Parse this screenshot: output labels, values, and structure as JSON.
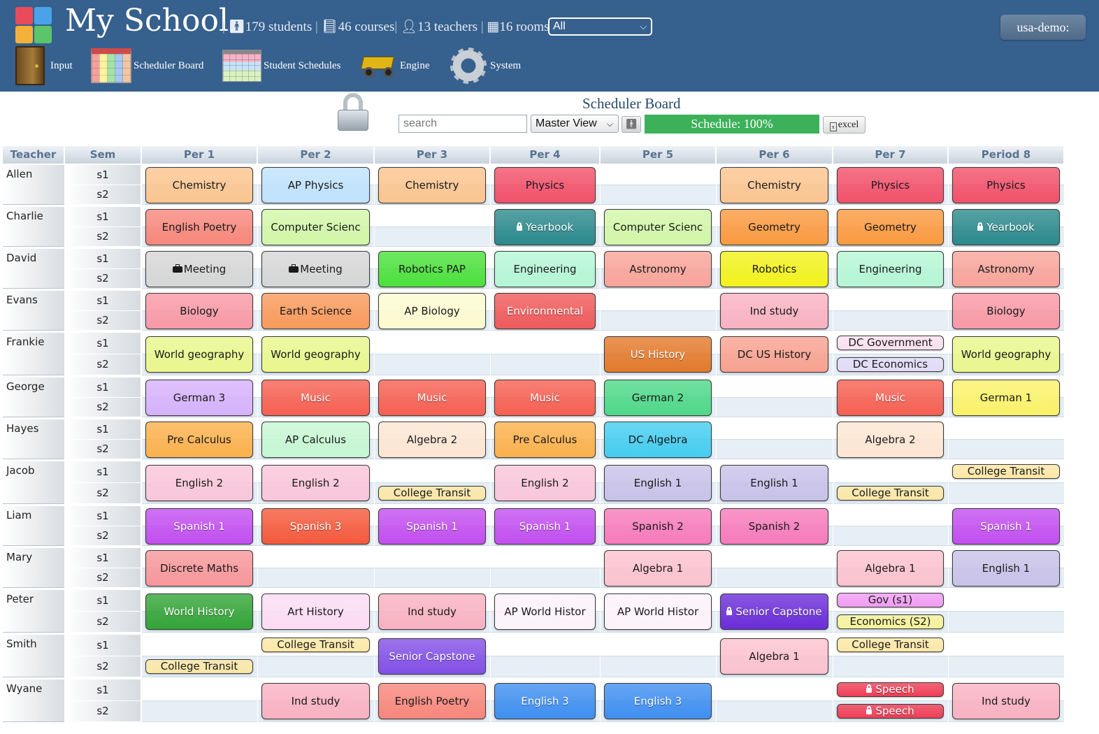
{
  "app": {
    "title": "My School",
    "stats": {
      "students": "179 students",
      "courses": "46 courses",
      "teachers": "13 teachers",
      "rooms": "16 rooms"
    },
    "scope_select": "All",
    "user_label": "usa-demo:"
  },
  "nav": [
    {
      "label": "Input",
      "icon": "door-icon"
    },
    {
      "label": "Scheduler Board",
      "icon": "calendar-board-icon"
    },
    {
      "label": "Student Schedules",
      "icon": "student-calendar-icon"
    },
    {
      "label": "Engine",
      "icon": "dump-truck-icon"
    },
    {
      "label": "System",
      "icon": "gear-icon"
    }
  ],
  "toolbar": {
    "board_title": "Scheduler Board",
    "search_placeholder": "search",
    "view_select": "Master View",
    "progress_label": "Schedule: 100%",
    "progress_value": 1.0,
    "excel_label": "excel"
  },
  "grid": {
    "headers": [
      "Teacher",
      "Sem",
      "Per 1",
      "Per 2",
      "Per 3",
      "Per 4",
      "Per 5",
      "Per 6",
      "Per 7",
      "Period 8"
    ],
    "sem_labels": [
      "s1",
      "s2"
    ],
    "teachers": [
      {
        "name": "Allen",
        "courses": [
          {
            "p": 0,
            "label": "Chemistry",
            "bg": "#fbc590",
            "span": "full"
          },
          {
            "p": 1,
            "label": "AP Physics",
            "bg": "#bfe2fb",
            "span": "full"
          },
          {
            "p": 2,
            "label": "Chemistry",
            "bg": "#fbc590",
            "span": "full"
          },
          {
            "p": 3,
            "label": "Physics",
            "bg": "#f2516a",
            "span": "full"
          },
          {
            "p": 5,
            "label": "Chemistry",
            "bg": "#fbc590",
            "span": "full"
          },
          {
            "p": 6,
            "label": "Physics",
            "bg": "#f2516a",
            "span": "full"
          },
          {
            "p": 7,
            "label": "Physics",
            "bg": "#f2516a",
            "span": "full"
          }
        ]
      },
      {
        "name": "Charlie",
        "courses": [
          {
            "p": 0,
            "label": "English Poetry",
            "bg": "#f8877c",
            "span": "full"
          },
          {
            "p": 1,
            "label": "Computer Scienc",
            "bg": "#d2f6a8",
            "span": "full"
          },
          {
            "p": 3,
            "label": "Yearbook",
            "bg": "#2c8a8c",
            "span": "full",
            "icon": "lock",
            "light": true
          },
          {
            "p": 4,
            "label": "Computer Scienc",
            "bg": "#d2f6a8",
            "span": "full"
          },
          {
            "p": 5,
            "label": "Geometry",
            "bg": "#fb9a40",
            "span": "full"
          },
          {
            "p": 6,
            "label": "Geometry",
            "bg": "#fb9a40",
            "span": "full"
          },
          {
            "p": 7,
            "label": "Yearbook",
            "bg": "#2c8a8c",
            "span": "full",
            "icon": "lock",
            "light": true
          }
        ]
      },
      {
        "name": "David",
        "courses": [
          {
            "p": 0,
            "label": "Meeting",
            "bg": "#d6d6d6",
            "span": "full",
            "icon": "briefcase"
          },
          {
            "p": 1,
            "label": "Meeting",
            "bg": "#d6d6d6",
            "span": "full",
            "icon": "briefcase"
          },
          {
            "p": 2,
            "label": "Robotics PAP",
            "bg": "#4ce13c",
            "span": "full"
          },
          {
            "p": 3,
            "label": "Engineering",
            "bg": "#b5f6d4",
            "span": "full"
          },
          {
            "p": 4,
            "label": "Astronomy",
            "bg": "#f8a49a",
            "span": "full"
          },
          {
            "p": 5,
            "label": "Robotics",
            "bg": "#f2f21c",
            "span": "full"
          },
          {
            "p": 6,
            "label": "Engineering",
            "bg": "#b5f6d4",
            "span": "full"
          },
          {
            "p": 7,
            "label": "Astronomy",
            "bg": "#f8a49a",
            "span": "full"
          }
        ]
      },
      {
        "name": "Evans",
        "courses": [
          {
            "p": 0,
            "label": "Biology",
            "bg": "#f899a6",
            "span": "full"
          },
          {
            "p": 1,
            "label": "Earth Science",
            "bg": "#f99a5c",
            "span": "full"
          },
          {
            "p": 2,
            "label": "AP Biology",
            "bg": "#fcfbd0",
            "span": "full"
          },
          {
            "p": 3,
            "label": "Environmental",
            "bg": "#ef5a5a",
            "span": "full",
            "light": true
          },
          {
            "p": 5,
            "label": "Ind study",
            "bg": "#f9b2c1",
            "span": "full"
          },
          {
            "p": 7,
            "label": "Biology",
            "bg": "#f899a6",
            "span": "full"
          }
        ]
      },
      {
        "name": "Frankie",
        "courses": [
          {
            "p": 0,
            "label": "World geography",
            "bg": "#e9f78d",
            "span": "full"
          },
          {
            "p": 1,
            "label": "World geography",
            "bg": "#e9f78d",
            "span": "full"
          },
          {
            "p": 4,
            "label": "US History",
            "bg": "#e37a2c",
            "span": "full",
            "light": true
          },
          {
            "p": 5,
            "label": "DC US History",
            "bg": "#f8a290",
            "span": "full"
          },
          {
            "p": 6,
            "label": "DC Government",
            "bg": "#f9e0ee",
            "span": "s1"
          },
          {
            "p": 6,
            "label": "DC Economics",
            "bg": "#e3dbf8",
            "span": "s2"
          },
          {
            "p": 7,
            "label": "World geography",
            "bg": "#e9f78d",
            "span": "full"
          }
        ]
      },
      {
        "name": "George",
        "courses": [
          {
            "p": 0,
            "label": "German 3",
            "bg": "#d6b2fb",
            "span": "full"
          },
          {
            "p": 1,
            "label": "Music",
            "bg": "#f66052",
            "span": "full",
            "light": true
          },
          {
            "p": 2,
            "label": "Music",
            "bg": "#f66052",
            "span": "full",
            "light": true
          },
          {
            "p": 3,
            "label": "Music",
            "bg": "#f66052",
            "span": "full",
            "light": true
          },
          {
            "p": 4,
            "label": "German 2",
            "bg": "#4fd889",
            "span": "full"
          },
          {
            "p": 6,
            "label": "Music",
            "bg": "#f66052",
            "span": "full",
            "light": true
          },
          {
            "p": 7,
            "label": "German 1",
            "bg": "#faf26a",
            "span": "full"
          }
        ]
      },
      {
        "name": "Hayes",
        "courses": [
          {
            "p": 0,
            "label": "Pre Calculus",
            "bg": "#fbb14c",
            "span": "full"
          },
          {
            "p": 1,
            "label": "AP Calculus",
            "bg": "#c6f7d3",
            "span": "full"
          },
          {
            "p": 2,
            "label": "Algebra 2",
            "bg": "#fde6d2",
            "span": "full"
          },
          {
            "p": 3,
            "label": "Pre Calculus",
            "bg": "#fbb14c",
            "span": "full"
          },
          {
            "p": 4,
            "label": "DC Algebra",
            "bg": "#45cdf0",
            "span": "full"
          },
          {
            "p": 6,
            "label": "Algebra 2",
            "bg": "#fde6d2",
            "span": "full"
          }
        ]
      },
      {
        "name": "Jacob",
        "courses": [
          {
            "p": 0,
            "label": "English 2",
            "bg": "#f9c6da",
            "span": "full"
          },
          {
            "p": 1,
            "label": "English 2",
            "bg": "#f9c6da",
            "span": "full"
          },
          {
            "p": 2,
            "label": "College Transit",
            "bg": "#fbe7a6",
            "span": "s2"
          },
          {
            "p": 3,
            "label": "English 2",
            "bg": "#f9c6da",
            "span": "full"
          },
          {
            "p": 4,
            "label": "English 1",
            "bg": "#c8c2e8",
            "span": "full"
          },
          {
            "p": 5,
            "label": "English 1",
            "bg": "#c8c2e8",
            "span": "full"
          },
          {
            "p": 6,
            "label": "College Transit",
            "bg": "#fbe7a6",
            "span": "s2"
          },
          {
            "p": 7,
            "label": "College Transit",
            "bg": "#fbe7a6",
            "span": "s1"
          }
        ]
      },
      {
        "name": "Liam",
        "courses": [
          {
            "p": 0,
            "label": "Spanish 1",
            "bg": "#c34ff0",
            "span": "full",
            "light": true
          },
          {
            "p": 1,
            "label": "Spanish 3",
            "bg": "#f55a3c",
            "span": "full",
            "light": true
          },
          {
            "p": 2,
            "label": "Spanish 1",
            "bg": "#c34ff0",
            "span": "full",
            "light": true
          },
          {
            "p": 3,
            "label": "Spanish 1",
            "bg": "#c34ff0",
            "span": "full",
            "light": true
          },
          {
            "p": 4,
            "label": "Spanish 2",
            "bg": "#f77bbb",
            "span": "full"
          },
          {
            "p": 5,
            "label": "Spanish 2",
            "bg": "#f77bbb",
            "span": "full"
          },
          {
            "p": 7,
            "label": "Spanish 1",
            "bg": "#c34ff0",
            "span": "full",
            "light": true
          }
        ]
      },
      {
        "name": "Mary",
        "courses": [
          {
            "p": 0,
            "label": "Discrete Maths",
            "bg": "#f7979a",
            "span": "full"
          },
          {
            "p": 4,
            "label": "Algebra 1",
            "bg": "#fbc2cf",
            "span": "full"
          },
          {
            "p": 6,
            "label": "Algebra 1",
            "bg": "#fbc2cf",
            "span": "full"
          },
          {
            "p": 7,
            "label": "English 1",
            "bg": "#c8c2e8",
            "span": "full"
          }
        ]
      },
      {
        "name": "Peter",
        "courses": [
          {
            "p": 0,
            "label": "World History",
            "bg": "#33a437",
            "span": "full",
            "light": true
          },
          {
            "p": 1,
            "label": "Art History",
            "bg": "#fcdcf4",
            "span": "full"
          },
          {
            "p": 2,
            "label": "Ind study",
            "bg": "#f9b2c1",
            "span": "full"
          },
          {
            "p": 3,
            "label": "AP World Histor",
            "bg": "#fdf2fa",
            "span": "full"
          },
          {
            "p": 4,
            "label": "AP World Histor",
            "bg": "#fdf2fa",
            "span": "full"
          },
          {
            "p": 5,
            "label": "Senior Capstone",
            "bg": "#6b2dd8",
            "span": "full",
            "icon": "lock",
            "light": true
          },
          {
            "p": 6,
            "label": "Gov (s1)",
            "bg": "#ef9cf3",
            "span": "s1"
          },
          {
            "p": 6,
            "label": "Economics (S2)",
            "bg": "#f6f39a",
            "span": "s2"
          }
        ]
      },
      {
        "name": "Smith",
        "courses": [
          {
            "p": 0,
            "label": "College Transit",
            "bg": "#fbe7a6",
            "span": "s2"
          },
          {
            "p": 1,
            "label": "College Transit",
            "bg": "#fbe7a6",
            "span": "s1"
          },
          {
            "p": 2,
            "label": "Senior Capstone",
            "bg": "#8350e6",
            "span": "full",
            "light": true
          },
          {
            "p": 5,
            "label": "Algebra 1",
            "bg": "#fbc2cf",
            "span": "full"
          },
          {
            "p": 6,
            "label": "College Transit",
            "bg": "#fbe7a6",
            "span": "s1"
          }
        ]
      },
      {
        "name": "Wyane",
        "courses": [
          {
            "p": 1,
            "label": "Ind study",
            "bg": "#f9b2c1",
            "span": "full"
          },
          {
            "p": 2,
            "label": "English Poetry",
            "bg": "#f8877c",
            "span": "full"
          },
          {
            "p": 3,
            "label": "English 3",
            "bg": "#3f8ff0",
            "span": "full",
            "light": true
          },
          {
            "p": 4,
            "label": "English 3",
            "bg": "#3f8ff0",
            "span": "full",
            "light": true
          },
          {
            "p": 6,
            "label": "Speech",
            "bg": "#ee3e56",
            "span": "s1",
            "icon": "lock",
            "light": true
          },
          {
            "p": 6,
            "label": "Speech",
            "bg": "#ee3e56",
            "span": "s2",
            "icon": "lock",
            "light": true
          },
          {
            "p": 7,
            "label": "Ind study",
            "bg": "#f9b2c1",
            "span": "full"
          }
        ]
      }
    ]
  }
}
